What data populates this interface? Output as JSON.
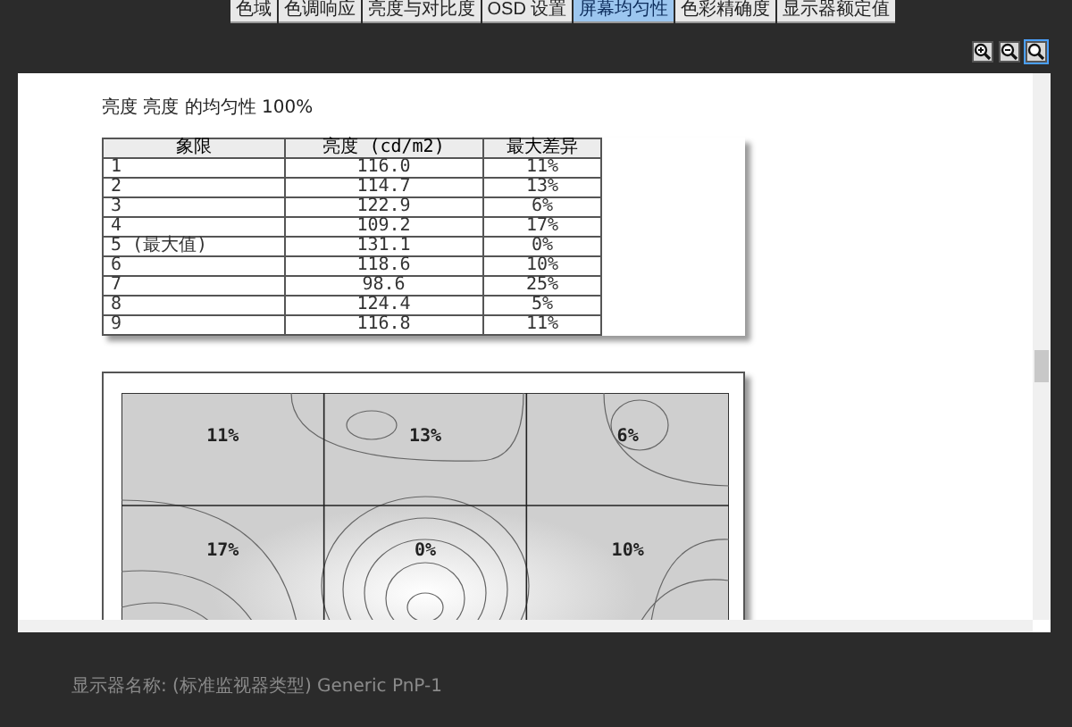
{
  "tabs": [
    {
      "label": "色域",
      "selected": false
    },
    {
      "label": "色调响应",
      "selected": false
    },
    {
      "label": "亮度与对比度",
      "selected": false
    },
    {
      "label": "OSD 设置",
      "selected": false
    },
    {
      "label": "屏幕均匀性",
      "selected": true
    },
    {
      "label": "色彩精确度",
      "selected": false
    },
    {
      "label": "显示器额定值",
      "selected": false
    }
  ],
  "report": {
    "title": "亮度 亮度 的均匀性 100%",
    "table": {
      "columns": [
        "象限",
        "亮度 (cd/m2)",
        "最大差异"
      ],
      "rows": [
        [
          "1",
          "116.0",
          "11%"
        ],
        [
          "2",
          "114.7",
          "13%"
        ],
        [
          "3",
          "122.9",
          "6%"
        ],
        [
          "4",
          "109.2",
          "17%"
        ],
        [
          "5 (最大值)",
          "131.1",
          "0%"
        ],
        [
          "6",
          "118.6",
          "10%"
        ],
        [
          "7",
          "98.6",
          "25%"
        ],
        [
          "8",
          "124.4",
          "5%"
        ],
        [
          "9",
          "116.8",
          "11%"
        ]
      ]
    },
    "heatmap": {
      "labels": [
        "11%",
        "13%",
        "6%",
        "17%",
        "0%",
        "10%"
      ]
    }
  },
  "footer": {
    "display_name": "显示器名称: (标准监视器类型) Generic PnP-1"
  }
}
